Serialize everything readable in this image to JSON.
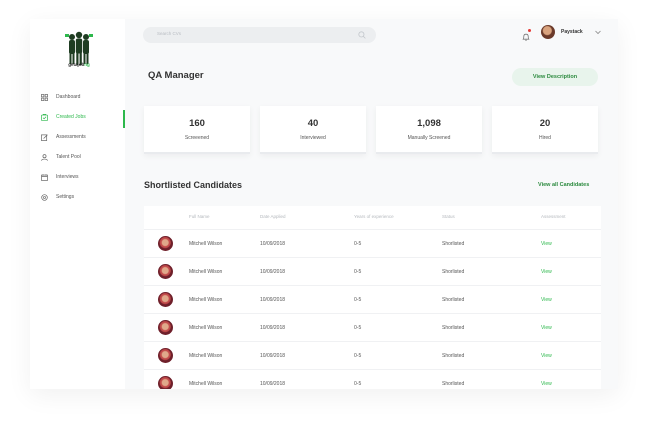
{
  "brand": {
    "logo_text_main": "getajob",
    "logo_text_accent": "ng"
  },
  "sidebar": {
    "items": [
      {
        "label": "Dashboard",
        "icon": "grid-icon",
        "active": false
      },
      {
        "label": "Created  Jobs",
        "icon": "jobs-icon",
        "active": true
      },
      {
        "label": "Assessments",
        "icon": "edit-icon",
        "active": false
      },
      {
        "label": "Talent Pool",
        "icon": "user-icon",
        "active": false
      },
      {
        "label": "Interviews",
        "icon": "calendar-icon",
        "active": false
      },
      {
        "label": "Settings",
        "icon": "gear-icon",
        "active": false
      }
    ]
  },
  "topbar": {
    "search_placeholder": "Search CVs",
    "username": "Paystack"
  },
  "page": {
    "title": "QA Manager",
    "view_description_label": "View Description"
  },
  "stats": [
    {
      "value": "160",
      "label": "Screeened"
    },
    {
      "value": "40",
      "label": "Interviewed"
    },
    {
      "value": "1,098",
      "label": "Manually Screened"
    },
    {
      "value": "20",
      "label": "Hired"
    }
  ],
  "shortlist": {
    "title": "Shortlisted Candidates",
    "view_all_label": "View all Candidates",
    "columns": [
      "Full Name",
      "Date Applied",
      "Years of experience",
      "Status",
      "Assessment"
    ],
    "rows": [
      {
        "name": "Mitchell Wilson",
        "date": "10/09/2018",
        "experience": "0-5",
        "status": "Shorlisted",
        "action": "View"
      },
      {
        "name": "Mitchell Wilson",
        "date": "10/09/2018",
        "experience": "0-5",
        "status": "Shorlisted",
        "action": "View"
      },
      {
        "name": "Mitchell Wilson",
        "date": "10/09/2018",
        "experience": "0-5",
        "status": "Shorlisted",
        "action": "View"
      },
      {
        "name": "Mitchell Wilson",
        "date": "10/09/2018",
        "experience": "0-5",
        "status": "Shorlisted",
        "action": "View"
      },
      {
        "name": "Mitchell Wilson",
        "date": "10/09/2018",
        "experience": "0-5",
        "status": "Shorlisted",
        "action": "View"
      },
      {
        "name": "Mitchell Wilson",
        "date": "10/09/2018",
        "experience": "0-5",
        "status": "Shorlisted",
        "action": "View"
      }
    ]
  },
  "colors": {
    "accent": "#2db84c",
    "accent_dark": "#2b8a3e",
    "accent_bg": "#e8f4ec"
  }
}
